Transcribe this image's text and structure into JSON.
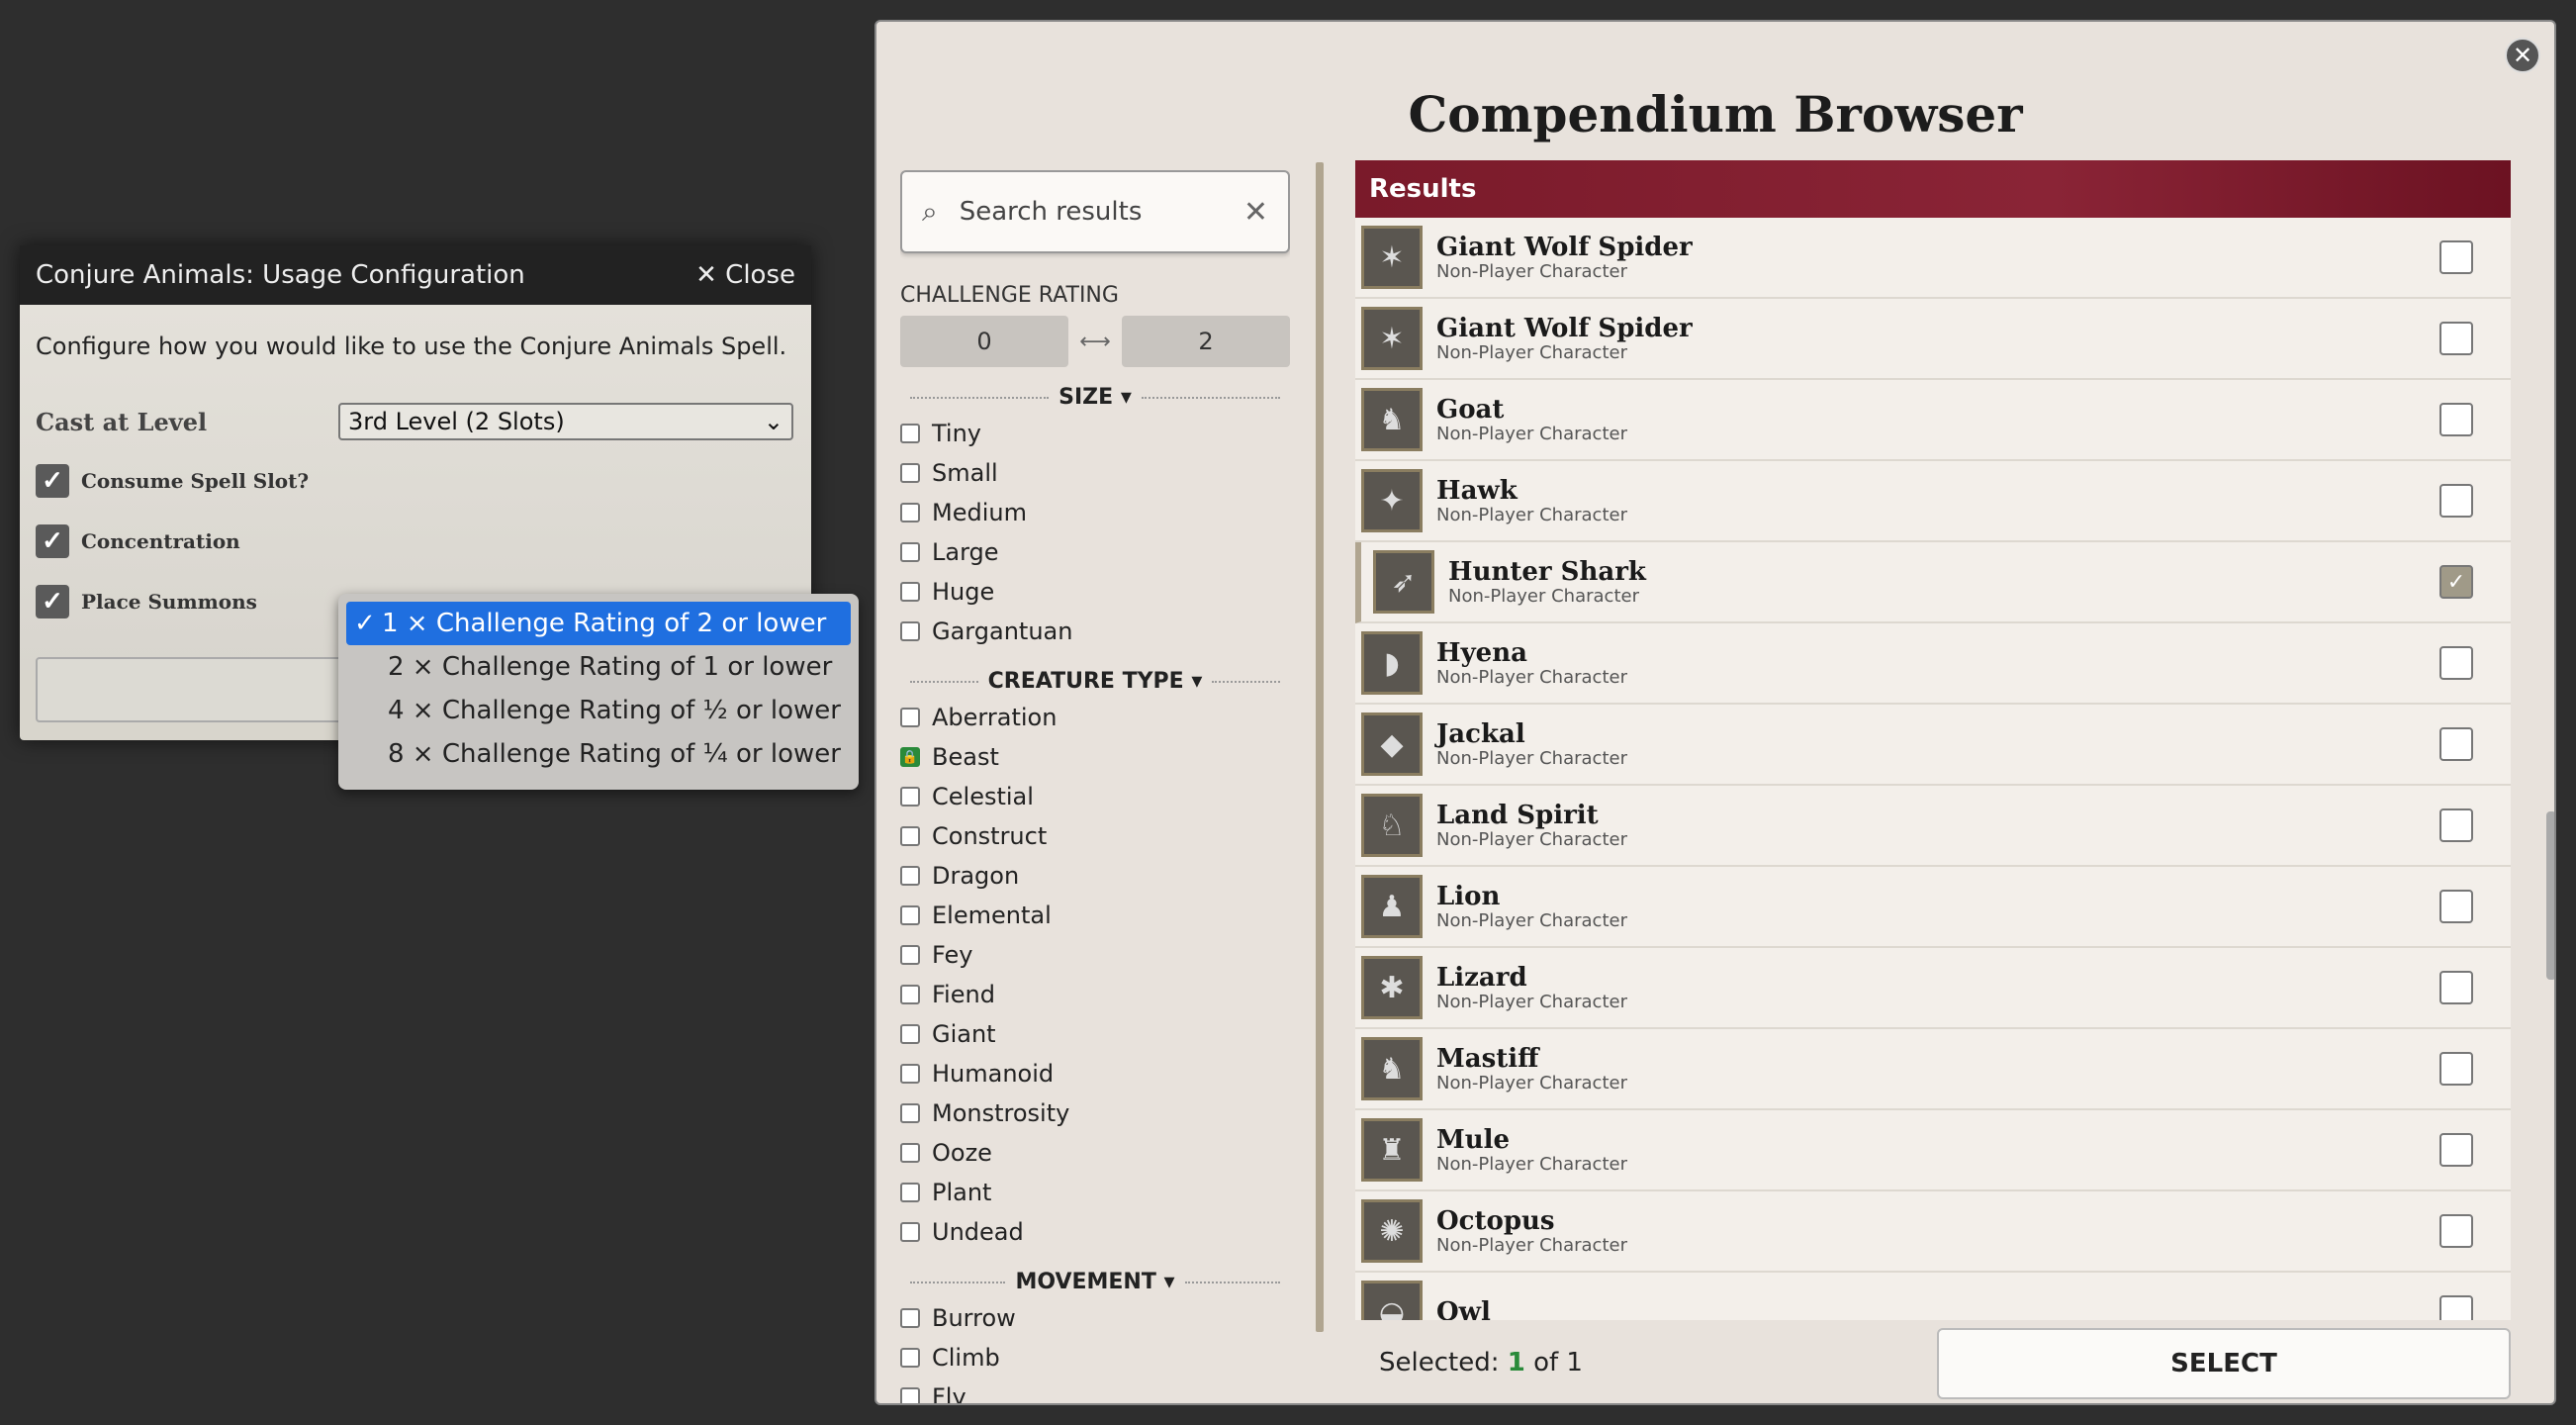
{
  "dialog": {
    "title": "Conjure Animals: Usage Configuration",
    "close_label": "✕ Close",
    "description": "Configure how you would like to use the Conjure Animals Spell.",
    "cast_label": "Cast at Level",
    "cast_value": "3rd Level (2 Slots)",
    "consume_label": "Consume Spell Slot?",
    "concentration_label": "Concentration",
    "place_label": "Place Summons"
  },
  "dropdown": {
    "options": [
      "1 × Challenge Rating of 2 or lower",
      "2 × Challenge Rating of 1 or lower",
      "4 × Challenge Rating of ½ or lower",
      "8 × Challenge Rating of ¼ or lower"
    ],
    "selected_index": 0
  },
  "browser": {
    "title": "Compendium Browser",
    "search_placeholder": "Search results",
    "cr_label": "CHALLENGE RATING",
    "cr_min": "0",
    "cr_max": "2",
    "size_label": "SIZE",
    "sizes": [
      "Tiny",
      "Small",
      "Medium",
      "Large",
      "Huge",
      "Gargantuan"
    ],
    "creature_label": "CREATURE TYPE",
    "creature_types": [
      "Aberration",
      "Beast",
      "Celestial",
      "Construct",
      "Dragon",
      "Elemental",
      "Fey",
      "Fiend",
      "Giant",
      "Humanoid",
      "Monstrosity",
      "Ooze",
      "Plant",
      "Undead"
    ],
    "movement_label": "MOVEMENT",
    "movements": [
      "Burrow",
      "Climb",
      "Fly"
    ],
    "results_label": "Results",
    "results": [
      {
        "name": "Giant Wolf Spider",
        "type": "Non-Player Character",
        "checked": false
      },
      {
        "name": "Giant Wolf Spider",
        "type": "Non-Player Character",
        "checked": false
      },
      {
        "name": "Goat",
        "type": "Non-Player Character",
        "checked": false
      },
      {
        "name": "Hawk",
        "type": "Non-Player Character",
        "checked": false
      },
      {
        "name": "Hunter Shark",
        "type": "Non-Player Character",
        "checked": true
      },
      {
        "name": "Hyena",
        "type": "Non-Player Character",
        "checked": false
      },
      {
        "name": "Jackal",
        "type": "Non-Player Character",
        "checked": false
      },
      {
        "name": "Land Spirit",
        "type": "Non-Player Character",
        "checked": false
      },
      {
        "name": "Lion",
        "type": "Non-Player Character",
        "checked": false
      },
      {
        "name": "Lizard",
        "type": "Non-Player Character",
        "checked": false
      },
      {
        "name": "Mastiff",
        "type": "Non-Player Character",
        "checked": false
      },
      {
        "name": "Mule",
        "type": "Non-Player Character",
        "checked": false
      },
      {
        "name": "Octopus",
        "type": "Non-Player Character",
        "checked": false
      },
      {
        "name": "Owl",
        "type": "",
        "checked": false
      }
    ],
    "selected_prefix": "Selected:",
    "selected_count": "1",
    "selected_suffix": "of 1",
    "select_button": "SELECT"
  }
}
